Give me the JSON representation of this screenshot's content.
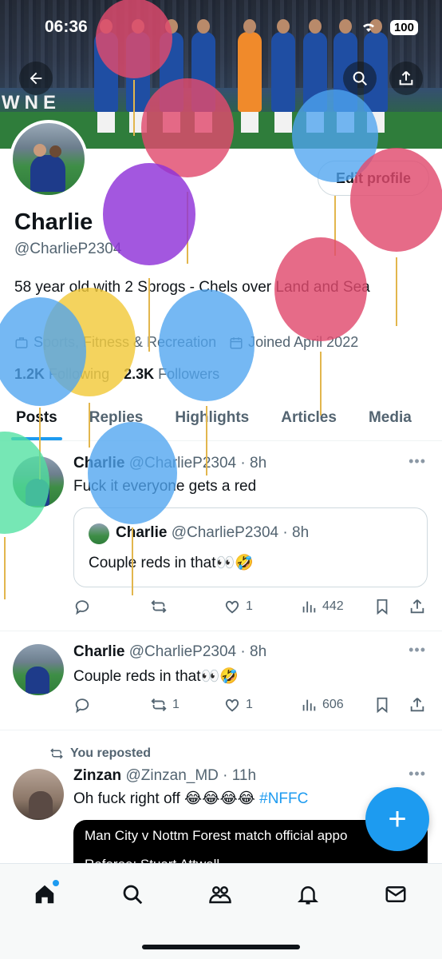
{
  "status_bar": {
    "time": "06:36",
    "battery": "100"
  },
  "banner": {
    "text": "WNE"
  },
  "header": {
    "back_icon": "arrow-left-icon",
    "search_icon": "search-icon",
    "share_icon": "share-icon"
  },
  "profile": {
    "name": "Charlie",
    "handle": "@CharlieP2304",
    "bio": "58 year old with 2 Sprogs - Chels over Land and Sea",
    "category": "Sports, Fitness & Recreation",
    "joined": "Joined April 2022",
    "following_count": "1.2K",
    "following_label": "Following",
    "followers_count": "2.3K",
    "followers_label": "Followers",
    "edit_label": "Edit profile"
  },
  "tabs": [
    {
      "label": "Posts"
    },
    {
      "label": "Replies"
    },
    {
      "label": "Highlights"
    },
    {
      "label": "Articles"
    },
    {
      "label": "Media"
    }
  ],
  "tweets": [
    {
      "name": "Charlie",
      "meta": "@CharlieP2304 · 8h",
      "text": "Fuck it everyone gets a red",
      "quote": {
        "name": "Charlie",
        "meta": "@CharlieP2304 · 8h",
        "text": "Couple reds in that👀🤣"
      },
      "replies": "",
      "reposts": "",
      "likes": "1",
      "views": "442"
    },
    {
      "name": "Charlie",
      "meta": "@CharlieP2304 · 8h",
      "text": "Couple reds in that👀🤣",
      "replies": "",
      "reposts": "1",
      "likes": "1",
      "views": "606"
    },
    {
      "repost_label": "You reposted",
      "name": "Zinzan",
      "meta": "@Zinzan_MD · 11h",
      "text_main": "Oh fuck right off 😂😂😂😂 ",
      "hashtag": "#NFFC",
      "card_line1": "Man City v Nottm Forest match official appo",
      "card_line2": "Referee: Stuart Attwell"
    }
  ],
  "fab": {
    "label": "+"
  },
  "colors": {
    "accent": "#1d9bf0",
    "text": "#0f1419",
    "secondary": "#536471"
  },
  "bottom_nav": [
    "home-icon",
    "search-icon",
    "communities-icon",
    "notifications-icon",
    "messages-icon"
  ]
}
